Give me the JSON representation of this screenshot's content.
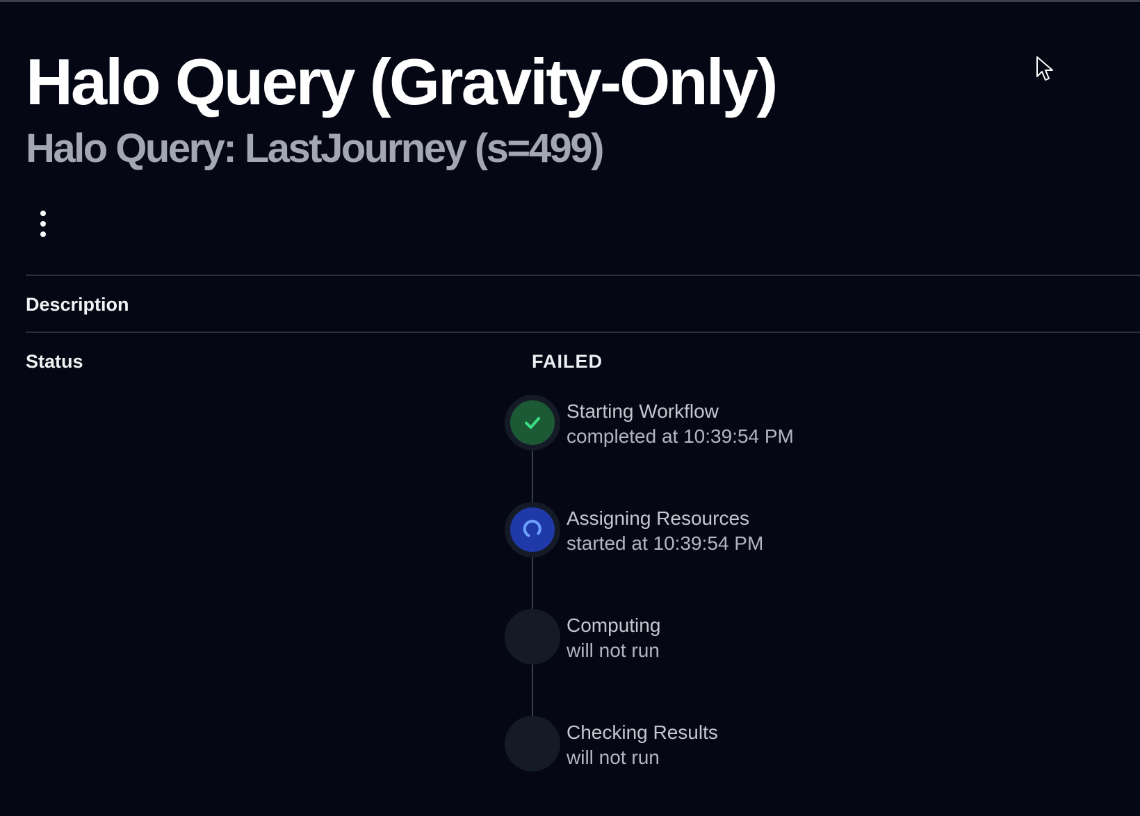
{
  "header": {
    "title": "Halo Query (Gravity-Only)",
    "subtitle": "Halo Query: LastJourney (s=499)"
  },
  "icons": {
    "menu": "more-vertical-icon",
    "cursor": "mouse-pointer-icon"
  },
  "fields": {
    "description_label": "Description",
    "status_label": "Status",
    "status_value": "FAILED"
  },
  "workflow": {
    "steps": [
      {
        "name": "Starting Workflow",
        "detail": "completed at 10:39:54 PM",
        "state": "completed",
        "icon": "check-icon"
      },
      {
        "name": "Assigning Resources",
        "detail": "started at 10:39:54 PM",
        "state": "in-progress",
        "icon": "spinner-icon"
      },
      {
        "name": "Computing",
        "detail": "will not run",
        "state": "skipped",
        "icon": ""
      },
      {
        "name": "Checking Results",
        "detail": "will not run",
        "state": "skipped",
        "icon": ""
      }
    ]
  },
  "colors": {
    "background": "#050814",
    "completed": "#1c5a35",
    "completed_check": "#3ddc84",
    "in_progress": "#1f3aa8",
    "spinner": "#6ea0ff",
    "pending": "#151a27"
  }
}
